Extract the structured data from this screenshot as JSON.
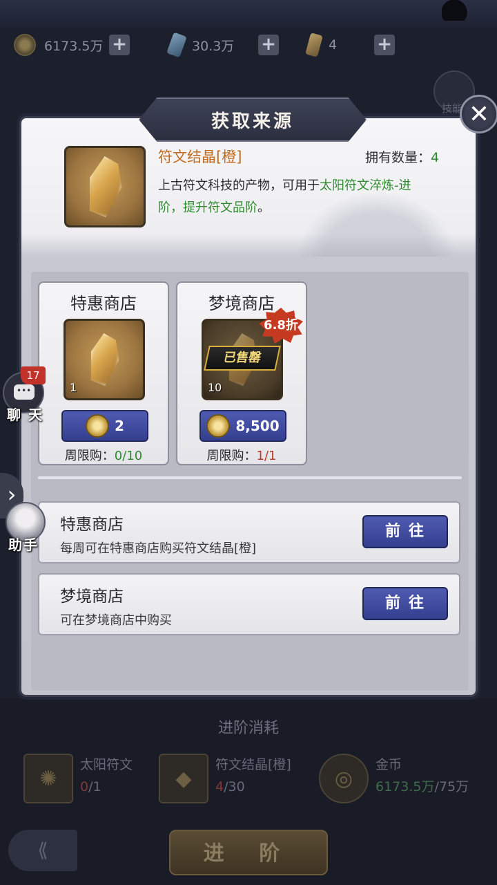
{
  "resources": [
    {
      "icon": "gold-coin-icon",
      "value": "6173.5万"
    },
    {
      "icon": "blue-crystal-icon",
      "value": "30.3万"
    },
    {
      "icon": "rune-crystal-icon",
      "value": "4"
    }
  ],
  "background": {
    "skill_label": "技能",
    "advance_cost_title": "进阶消耗",
    "costs": [
      {
        "name": "太阳符文",
        "have": "0",
        "need": "/1"
      },
      {
        "name": "符文结晶[橙]",
        "have": "4",
        "need": "/30"
      },
      {
        "name": "金币",
        "have": "6173.5万",
        "need": "/75万"
      }
    ],
    "advance_button": "进 阶"
  },
  "side": {
    "chat_badge": "17",
    "chat_label": "聊 天",
    "helper_label": "助手"
  },
  "modal": {
    "title": "获取来源",
    "item": {
      "name": "符文结晶[橙]",
      "own_label": "拥有数量：",
      "own_count": "4",
      "desc_prefix": "上古符文科技的产物，可用于",
      "desc_highlight": "太阳符文淬炼-进阶，提升符文品阶",
      "desc_suffix": "。"
    },
    "shops": [
      {
        "title": "特惠商店",
        "quantity": "1",
        "price": "2",
        "limit_label": "周限购：",
        "limit_value": "0/10",
        "sold_out": false
      },
      {
        "title": "梦境商店",
        "quantity": "10",
        "price": "8,500",
        "limit_label": "周限购：",
        "limit_value": "1/1",
        "sold_out": true,
        "sold_label": "已售罄",
        "discount": "6.8折"
      }
    ],
    "sources": [
      {
        "name": "特惠商店",
        "desc": "每周可在特惠商店购买符文结晶[橙]",
        "button": "前往"
      },
      {
        "name": "梦境商店",
        "desc": "可在梦境商店中购买",
        "button": "前往"
      }
    ]
  },
  "colors": {
    "item_name": "#c06a1e",
    "highlight_green": "#2e8a2e",
    "limit_red": "#b83a2c",
    "button_blue": "#4f5bb1"
  }
}
